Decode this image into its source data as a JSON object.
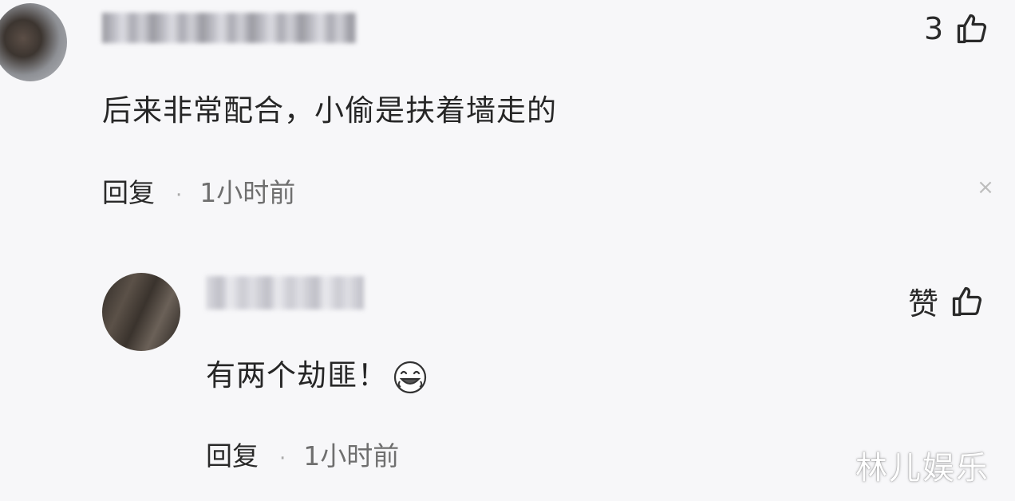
{
  "comments": [
    {
      "text": "后来非常配合，小偷是扶着墙走的",
      "like_count": "3",
      "reply_label": "回复",
      "separator": "·",
      "time": "1小时前"
    },
    {
      "text": "有两个劫匪！",
      "like_label": "赞",
      "reply_label": "回复",
      "separator": "·",
      "time": "1小时前"
    }
  ],
  "close_symbol": "×",
  "watermark": "林儿娱乐",
  "icons": {
    "like": "thumbs-up-icon",
    "close": "close-icon",
    "emoji": "laughing-emoji-icon"
  }
}
